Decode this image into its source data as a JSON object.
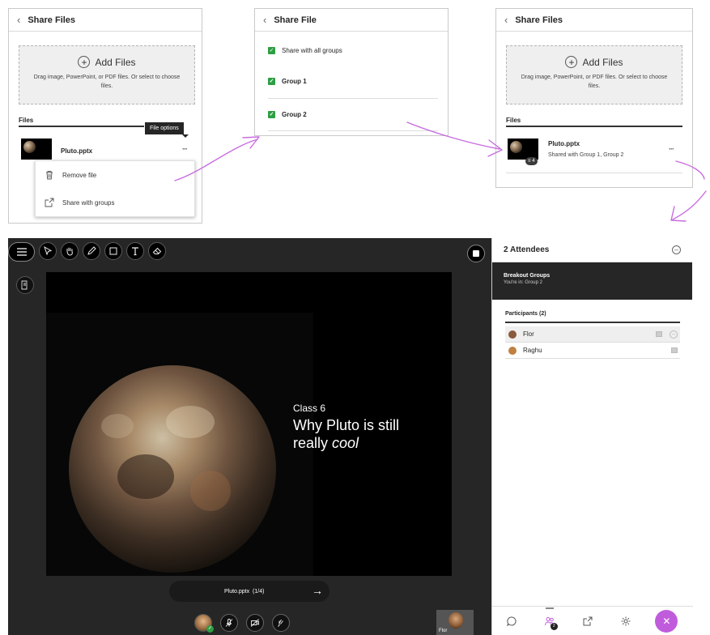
{
  "panel1": {
    "title": "Share Files",
    "add_files_label": "Add Files",
    "add_files_desc": "Drag image, PowerPoint, or PDF files. Or select to choose files.",
    "files_heading": "Files",
    "file_name": "Pluto.pptx",
    "tooltip": "File options",
    "menu": [
      {
        "label": "Remove file",
        "icon": "trash-icon"
      },
      {
        "label": "Share with groups",
        "icon": "share-icon"
      }
    ]
  },
  "panel2": {
    "title": "Share File",
    "options": [
      {
        "label": "Share with all groups",
        "checked": true
      },
      {
        "label": "Group 1",
        "checked": true
      },
      {
        "label": "Group 2",
        "checked": true
      }
    ]
  },
  "panel3": {
    "title": "Share Files",
    "add_files_label": "Add Files",
    "add_files_desc": "Drag image, PowerPoint, or PDF files. Or select to choose files.",
    "files_heading": "Files",
    "file_name": "Pluto.pptx",
    "file_shared_with": "Shared with Group 1, Group 2",
    "badge_count": "4"
  },
  "slide": {
    "subtitle": "Class 6",
    "title_line": "Why Pluto is still",
    "title_end_plain": "really ",
    "title_end_em": "cool"
  },
  "pager": {
    "label": "Pluto.pptx  (1/4)"
  },
  "camera": {
    "name": "Flor"
  },
  "sidebar": {
    "header": "2 Attendees",
    "breakout_title": "Breakout Groups",
    "breakout_sub": "You're in: Group 2",
    "participants_heading": "Participants (2)",
    "participants": [
      {
        "name": "Flor",
        "avatar_color": "#8a5a3c"
      },
      {
        "name": "Raghu",
        "avatar_color": "#c08040"
      }
    ],
    "attendee_badge": "2"
  },
  "colors": {
    "accent": "#c05cdc",
    "check": "#2e9e44",
    "arrow": "#c86de0"
  }
}
